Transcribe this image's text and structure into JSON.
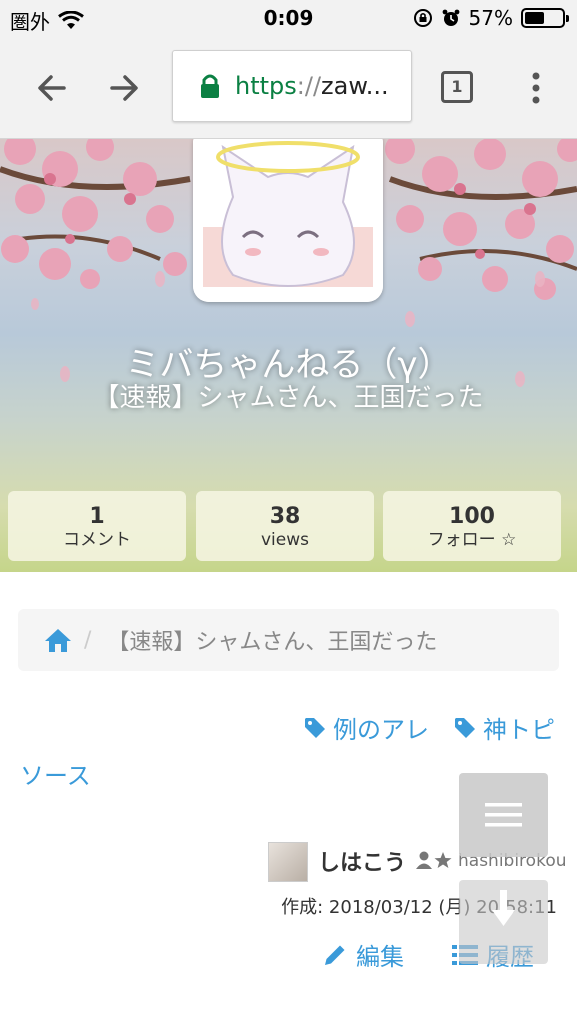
{
  "status_bar": {
    "carrier": "圏外",
    "time": "0:09",
    "battery_percent": "57%",
    "battery_level": 0.57
  },
  "browser": {
    "url_scheme": "https",
    "url_separator": "://",
    "url_host": "zaw...",
    "tab_count": "1"
  },
  "hero": {
    "title": "ミバちゃんねる（γ）",
    "subtitle": "【速報】シャムさん、王国だった",
    "stats": [
      {
        "value": "1",
        "label": "コメント"
      },
      {
        "value": "38",
        "label": "views"
      },
      {
        "value": "100",
        "label": "フォロー ☆"
      }
    ]
  },
  "breadcrumb": {
    "separator": "/",
    "current": "【速報】シャムさん、王国だった"
  },
  "tags": [
    {
      "label": "例のアレ",
      "icon": "tag-icon"
    },
    {
      "label": "神トピ",
      "icon": "tag-icon"
    }
  ],
  "source_link": "ソース",
  "author": {
    "name": "しはこう",
    "badge_icon": "user-star-icon",
    "handle": "hashibirokou",
    "created": "作成: 2018/03/12 (月) 20:58:11"
  },
  "actions": {
    "edit_label": "編集",
    "history_label": "履歴"
  },
  "colors": {
    "link": "#3a9ad9",
    "secure": "#0b8043"
  }
}
